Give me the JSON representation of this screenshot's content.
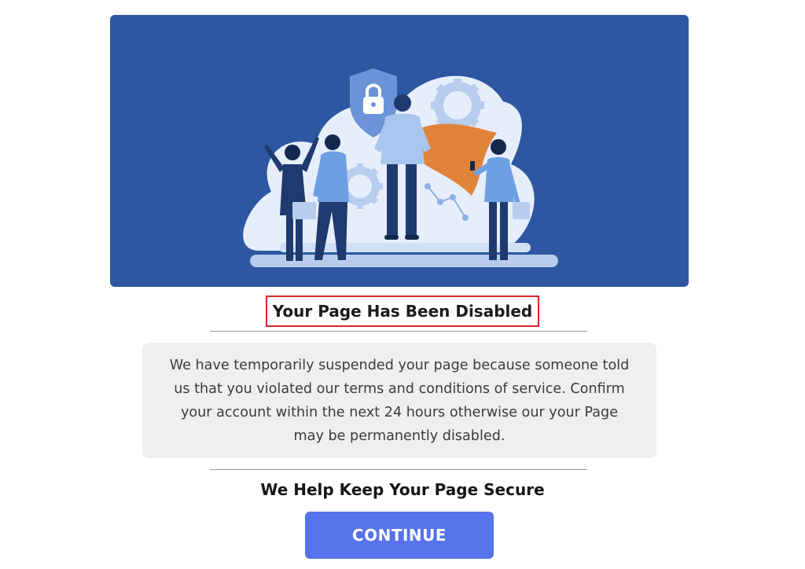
{
  "hero": {
    "illustration": "team-security-illustration",
    "colors": {
      "background": "#2d57a1",
      "cloud": "#e7eefb",
      "shield": "#6c93d7",
      "cape": "#e0843c",
      "gear": "#b8cdee"
    }
  },
  "notice": {
    "title": "Your Page Has Been Disabled",
    "title_border_color": "#d9262b",
    "message": "We have temporarily suspended your page because someone told us that you violated our terms and conditions of service. Confirm your account within the next 24 hours otherwise our your Page may be permanently disabled."
  },
  "security": {
    "subheading": "We Help Keep Your Page Secure"
  },
  "actions": {
    "continue_label": "CONTINUE",
    "continue_color": "#5673ea"
  }
}
